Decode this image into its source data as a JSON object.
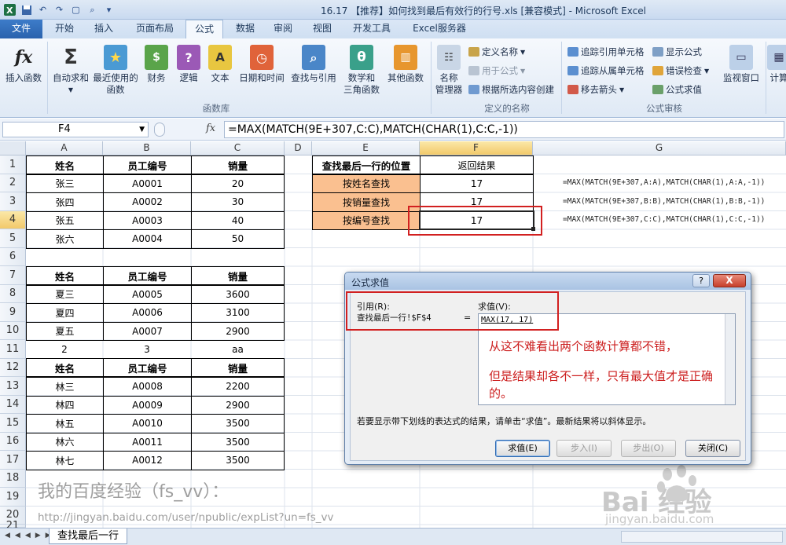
{
  "window": {
    "title": "16.17 【推荐】如何找到最后有效行的行号.xls  [兼容模式] - Microsoft Excel"
  },
  "ribbon_tabs": [
    "文件",
    "开始",
    "插入",
    "页面布局",
    "公式",
    "数据",
    "审阅",
    "视图",
    "开发工具",
    "Excel服务器"
  ],
  "ribbon": {
    "insert_function": "插入函数",
    "autosum": "自动求和",
    "recent_line1": "最近使用的",
    "recent_line2": "函数",
    "financial": "财务",
    "logical": "逻辑",
    "text": "文本",
    "datetime": "日期和时间",
    "lookup": "查找与引用",
    "math_line1": "数学和",
    "math_line2": "三角函数",
    "other": "其他函数",
    "group_library": "函数库",
    "name_mgr_line1": "名称",
    "name_mgr_line2": "管理器",
    "define_name": "定义名称",
    "use_in_formula": "用于公式",
    "create_from_sel": "根据所选内容创建",
    "group_names": "定义的名称",
    "trace_precedents": "追踪引用单元格",
    "trace_dependents": "追踪从属单元格",
    "remove_arrows": "移去箭头",
    "show_formulas": "显示公式",
    "error_check": "错误检查",
    "evaluate_formula": "公式求值",
    "group_audit": "公式审核",
    "watch_window": "监视窗口",
    "calc": "计算"
  },
  "formula_bar": {
    "name_box": "F4",
    "fx": "fx",
    "formula": "=MAX(MATCH(9E+307,C:C),MATCH(CHAR(1),C:C,-1))"
  },
  "columns": [
    "A",
    "B",
    "C",
    "D",
    "E",
    "F",
    "G"
  ],
  "rows": [
    "1",
    "2",
    "3",
    "4",
    "5",
    "6",
    "7",
    "8",
    "9",
    "10",
    "11",
    "12",
    "13",
    "14",
    "15",
    "16",
    "17",
    "18",
    "19",
    "20",
    "21"
  ],
  "table1": {
    "headers": [
      "姓名",
      "员工编号",
      "销量"
    ],
    "rows": [
      [
        "张三",
        "A0001",
        "20"
      ],
      [
        "张四",
        "A0002",
        "30"
      ],
      [
        "张五",
        "A0003",
        "40"
      ],
      [
        "张六",
        "A0004",
        "50"
      ]
    ]
  },
  "table2": {
    "headers": [
      "姓名",
      "员工编号",
      "销量"
    ],
    "rows": [
      [
        "夏三",
        "A0005",
        "3600"
      ],
      [
        "夏四",
        "A0006",
        "3100"
      ],
      [
        "夏五",
        "A0007",
        "2900"
      ]
    ]
  },
  "row11": [
    "2",
    "3",
    "aa"
  ],
  "table3": {
    "headers": [
      "姓名",
      "员工编号",
      "销量"
    ],
    "rows": [
      [
        "林三",
        "A0008",
        "2200"
      ],
      [
        "林四",
        "A0009",
        "2900"
      ],
      [
        "林五",
        "A0010",
        "3500"
      ],
      [
        "林六",
        "A0011",
        "3500"
      ],
      [
        "林七",
        "A0012",
        "3500"
      ]
    ]
  },
  "lookup_table": {
    "header_left": "查找最后一行的位置",
    "header_right": "返回结果",
    "rows": [
      [
        "按姓名查找",
        "17"
      ],
      [
        "按销量查找",
        "17"
      ],
      [
        "按编号查找",
        "17"
      ]
    ]
  },
  "formula_notes": [
    "=MAX(MATCH(9E+307,A:A),MATCH(CHAR(1),A:A,-1))",
    "=MAX(MATCH(9E+307,B:B),MATCH(CHAR(1),B:B,-1))",
    "=MAX(MATCH(9E+307,C:C),MATCH(CHAR(1),C:C,-1))"
  ],
  "watermark": {
    "line1": "我的百度经验（fs_vv）：",
    "line2": "http://jingyan.baidu.com/user/npublic/expList?un=fs_vv",
    "baidu": "Bai  经验",
    "baidu_url": "jingyan.baidu.com"
  },
  "sheet_tab": "查找最后一行",
  "dialog": {
    "title": "公式求值",
    "help": "?",
    "close": "X",
    "ref_label": "引用(R):",
    "ref_value": "查找最后一行!$F$4",
    "equals": "=",
    "eval_label": "求值(V):",
    "expression": "MAX(17, 17)",
    "annotation1": "从这不难看出两个函数计算都不错，",
    "annotation2": "但是结果却各不一样，只有最大值才是正确",
    "annotation3": "的。",
    "hint": "若要显示带下划线的表达式的结果，请单击“求值”。最新结果将以斜体显示。",
    "btn_evaluate": "求值(E)",
    "btn_step_in": "步入(I)",
    "btn_step_out": "步出(O)",
    "btn_close": "关闭(C)"
  }
}
